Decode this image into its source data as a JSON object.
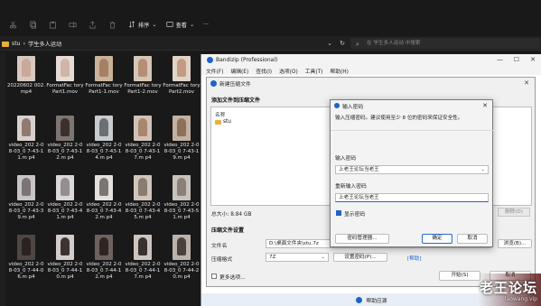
{
  "explorer": {
    "toolbar": {
      "sort_label": "排序",
      "view_label": "查看",
      "more_label": "···"
    },
    "breadcrumb": {
      "root": "stu",
      "sep": "›",
      "folder": "学生多人运动"
    },
    "search_placeholder": "在 学生多人运动 中搜索",
    "files": [
      {
        "name": "20220602 002.mp4",
        "bg": "#d9c8c0",
        "fig": "#c9a99a"
      },
      {
        "name": "FormatFac toryPart1.mov",
        "bg": "#e6dcd4",
        "fig": "#cfb6a8"
      },
      {
        "name": "FormatFac toryPart1-1.mov",
        "bg": "#c8b29a",
        "fig": "#a58063"
      },
      {
        "name": "FormatFac toryPart1-2.mov",
        "bg": "#d6c6b6",
        "fig": "#b68e76"
      },
      {
        "name": "FormatFac toryPart2.mov",
        "bg": "#e0d4c8",
        "fig": "#c49a83"
      },
      {
        "name": "video_202 2-08-03_0 7-43-11.m p4",
        "bg": "#d8d0cc",
        "fig": "#8f7a70"
      },
      {
        "name": "video_202 2-08-03_0 7-43-12.m p4",
        "bg": "#7e7470",
        "fig": "#3a302c"
      },
      {
        "name": "video_202 2-08-03_0 7-43-14.m p4",
        "bg": "#c8ccd0",
        "fig": "#6b6e72"
      },
      {
        "name": "video_202 2-08-03_0 7-43-17.m p4",
        "bg": "#d2c2b6",
        "fig": "#a88670"
      },
      {
        "name": "video_202 2-08-03_0 7-43-19.m p4",
        "bg": "#c3b0a0",
        "fig": "#8e6f58"
      },
      {
        "name": "video_202 2-08-03_0 7-43-39.m p4",
        "bg": "#c8c4c6",
        "fig": "#7a7478"
      },
      {
        "name": "video_202 2-08-03_0 7-43-41.m p4",
        "bg": "#dcd8da",
        "fig": "#958e92"
      },
      {
        "name": "video_202 2-08-03_0 7-43-42.m p4",
        "bg": "#e4e0de",
        "fig": "#7c7672"
      },
      {
        "name": "video_202 2-08-03_0 7-43-45.m p4",
        "bg": "#d0c6bc",
        "fig": "#8c7c70"
      },
      {
        "name": "video_202 2-08-03_0 7-43-51.m p4",
        "bg": "#c8c2bc",
        "fig": "#8a8078"
      },
      {
        "name": "video_202 2-08-03_0 7-44-06.m p4",
        "bg": "#4e4644",
        "fig": "#2a2220"
      },
      {
        "name": "video_202 2-08-03_0 7-44-10.m p4",
        "bg": "#d4ccc8",
        "fig": "#3c3432"
      },
      {
        "name": "video_202 2-08-03_0 7-44-12.m p4",
        "bg": "#6e625e",
        "fig": "#2e2422"
      },
      {
        "name": "video_202 2-08-03_0 7-44-17.m p4",
        "bg": "#cdc5c0",
        "fig": "#3a3230"
      },
      {
        "name": "video_202 2-08-03_0 7-44-20.m p4",
        "bg": "#bcb2ac",
        "fig": "#4a403c"
      }
    ]
  },
  "bandizip": {
    "title": "Bandizip (Professional)",
    "menu": [
      "文件(F)",
      "编辑(E)",
      "查找(I)",
      "选项(O)",
      "工具(T)",
      "帮助(H)"
    ],
    "help_center": "帮助应源"
  },
  "create": {
    "title": "新建压缩文件",
    "add_section": "添加文件到压缩文件",
    "col_name": "名称",
    "item": "stu",
    "total_label": "总大小:",
    "total_value": "8.84 GB",
    "delete_btn": "删除(D)",
    "settings_section": "压缩文件设置",
    "filename_label": "文件名",
    "filename_value": "D:\\桌面文件夹\\stu.7z",
    "browse_btn": "浏览(B)...",
    "format_label": "压缩格式",
    "format_value": "7Z",
    "set_password_btn": "设置密码(P)...",
    "help_link": "[帮助]",
    "more_options": "更多选项...",
    "start_btn": "开始(S)",
    "cancel_btn": "取消"
  },
  "password": {
    "title": "输入密码",
    "desc": "输入压缩密码。建议使用至少 8 位的密码来保证安全性。",
    "enter_label": "输入密码",
    "enter_value": "上老王论坛当老王",
    "reenter_label": "重新输入密码",
    "reenter_value": "上老王论坛当老王",
    "show_password": "显示密码",
    "manager_btn": "密码管理器...",
    "ok_btn": "确定",
    "cancel_btn": "取消"
  },
  "watermark": {
    "big": "老王论坛",
    "small": "laowang.vip"
  },
  "colors": {
    "accent": "#1e63c8",
    "folder": "#e8b23a",
    "explorer_bg": "#191919"
  }
}
